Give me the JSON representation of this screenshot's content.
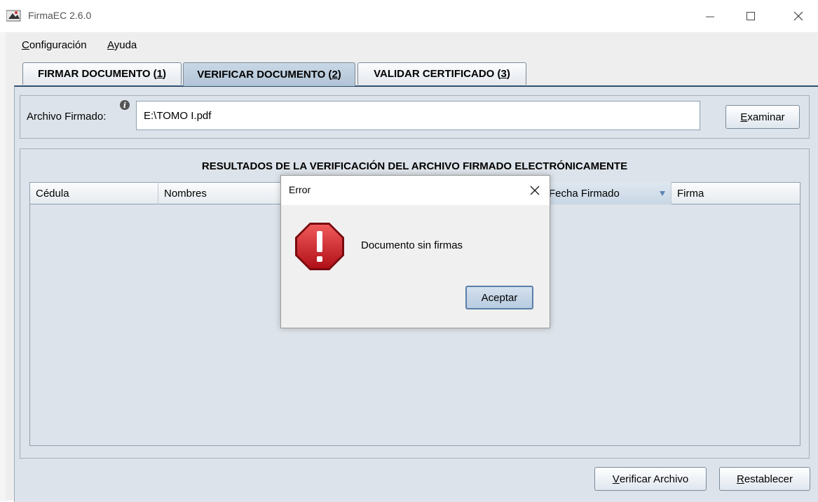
{
  "window": {
    "title": "FirmaEC 2.6.0",
    "controls": [
      "minimize-icon",
      "maximize-icon",
      "close-icon"
    ]
  },
  "menu": {
    "items": [
      {
        "pre": "",
        "mnemonic": "C",
        "post": "onfiguración"
      },
      {
        "pre": "",
        "mnemonic": "A",
        "post": "yuda"
      }
    ]
  },
  "tabs": [
    {
      "label": "FIRMAR DOCUMENTO (",
      "mnemonic": "1",
      "close": ")",
      "active": false
    },
    {
      "label": "VERIFICAR DOCUMENTO (",
      "mnemonic": "2",
      "close": ")",
      "active": true
    },
    {
      "label": "VALIDAR CERTIFICADO (",
      "mnemonic": "3",
      "close": ")",
      "active": false
    }
  ],
  "file": {
    "label": "Archivo Firmado:",
    "value": "E:\\TOMO I.pdf",
    "browse_mnemonic": "E",
    "browse_rest": "xaminar"
  },
  "results": {
    "title": "RESULTADOS DE LA VERIFICACIÓN DEL ARCHIVO FIRMADO ELECTRÓNICAMENTE",
    "columns": [
      "Cédula",
      "Nombres",
      "Fecha Firmado",
      "Firma"
    ],
    "rows": []
  },
  "actions": {
    "verify_mnemonic": "V",
    "verify_rest": "erificar Archivo",
    "reset_mnemonic": "R",
    "reset_rest": "establecer"
  },
  "dialog": {
    "title": "Error",
    "message": "Documento sin firmas",
    "ok_label": "Aceptar",
    "icon": "error-stop-icon"
  },
  "colors": {
    "active_tab": "#b1c4d6",
    "panel": "#dde3ea",
    "error_red": "#d0232b"
  }
}
